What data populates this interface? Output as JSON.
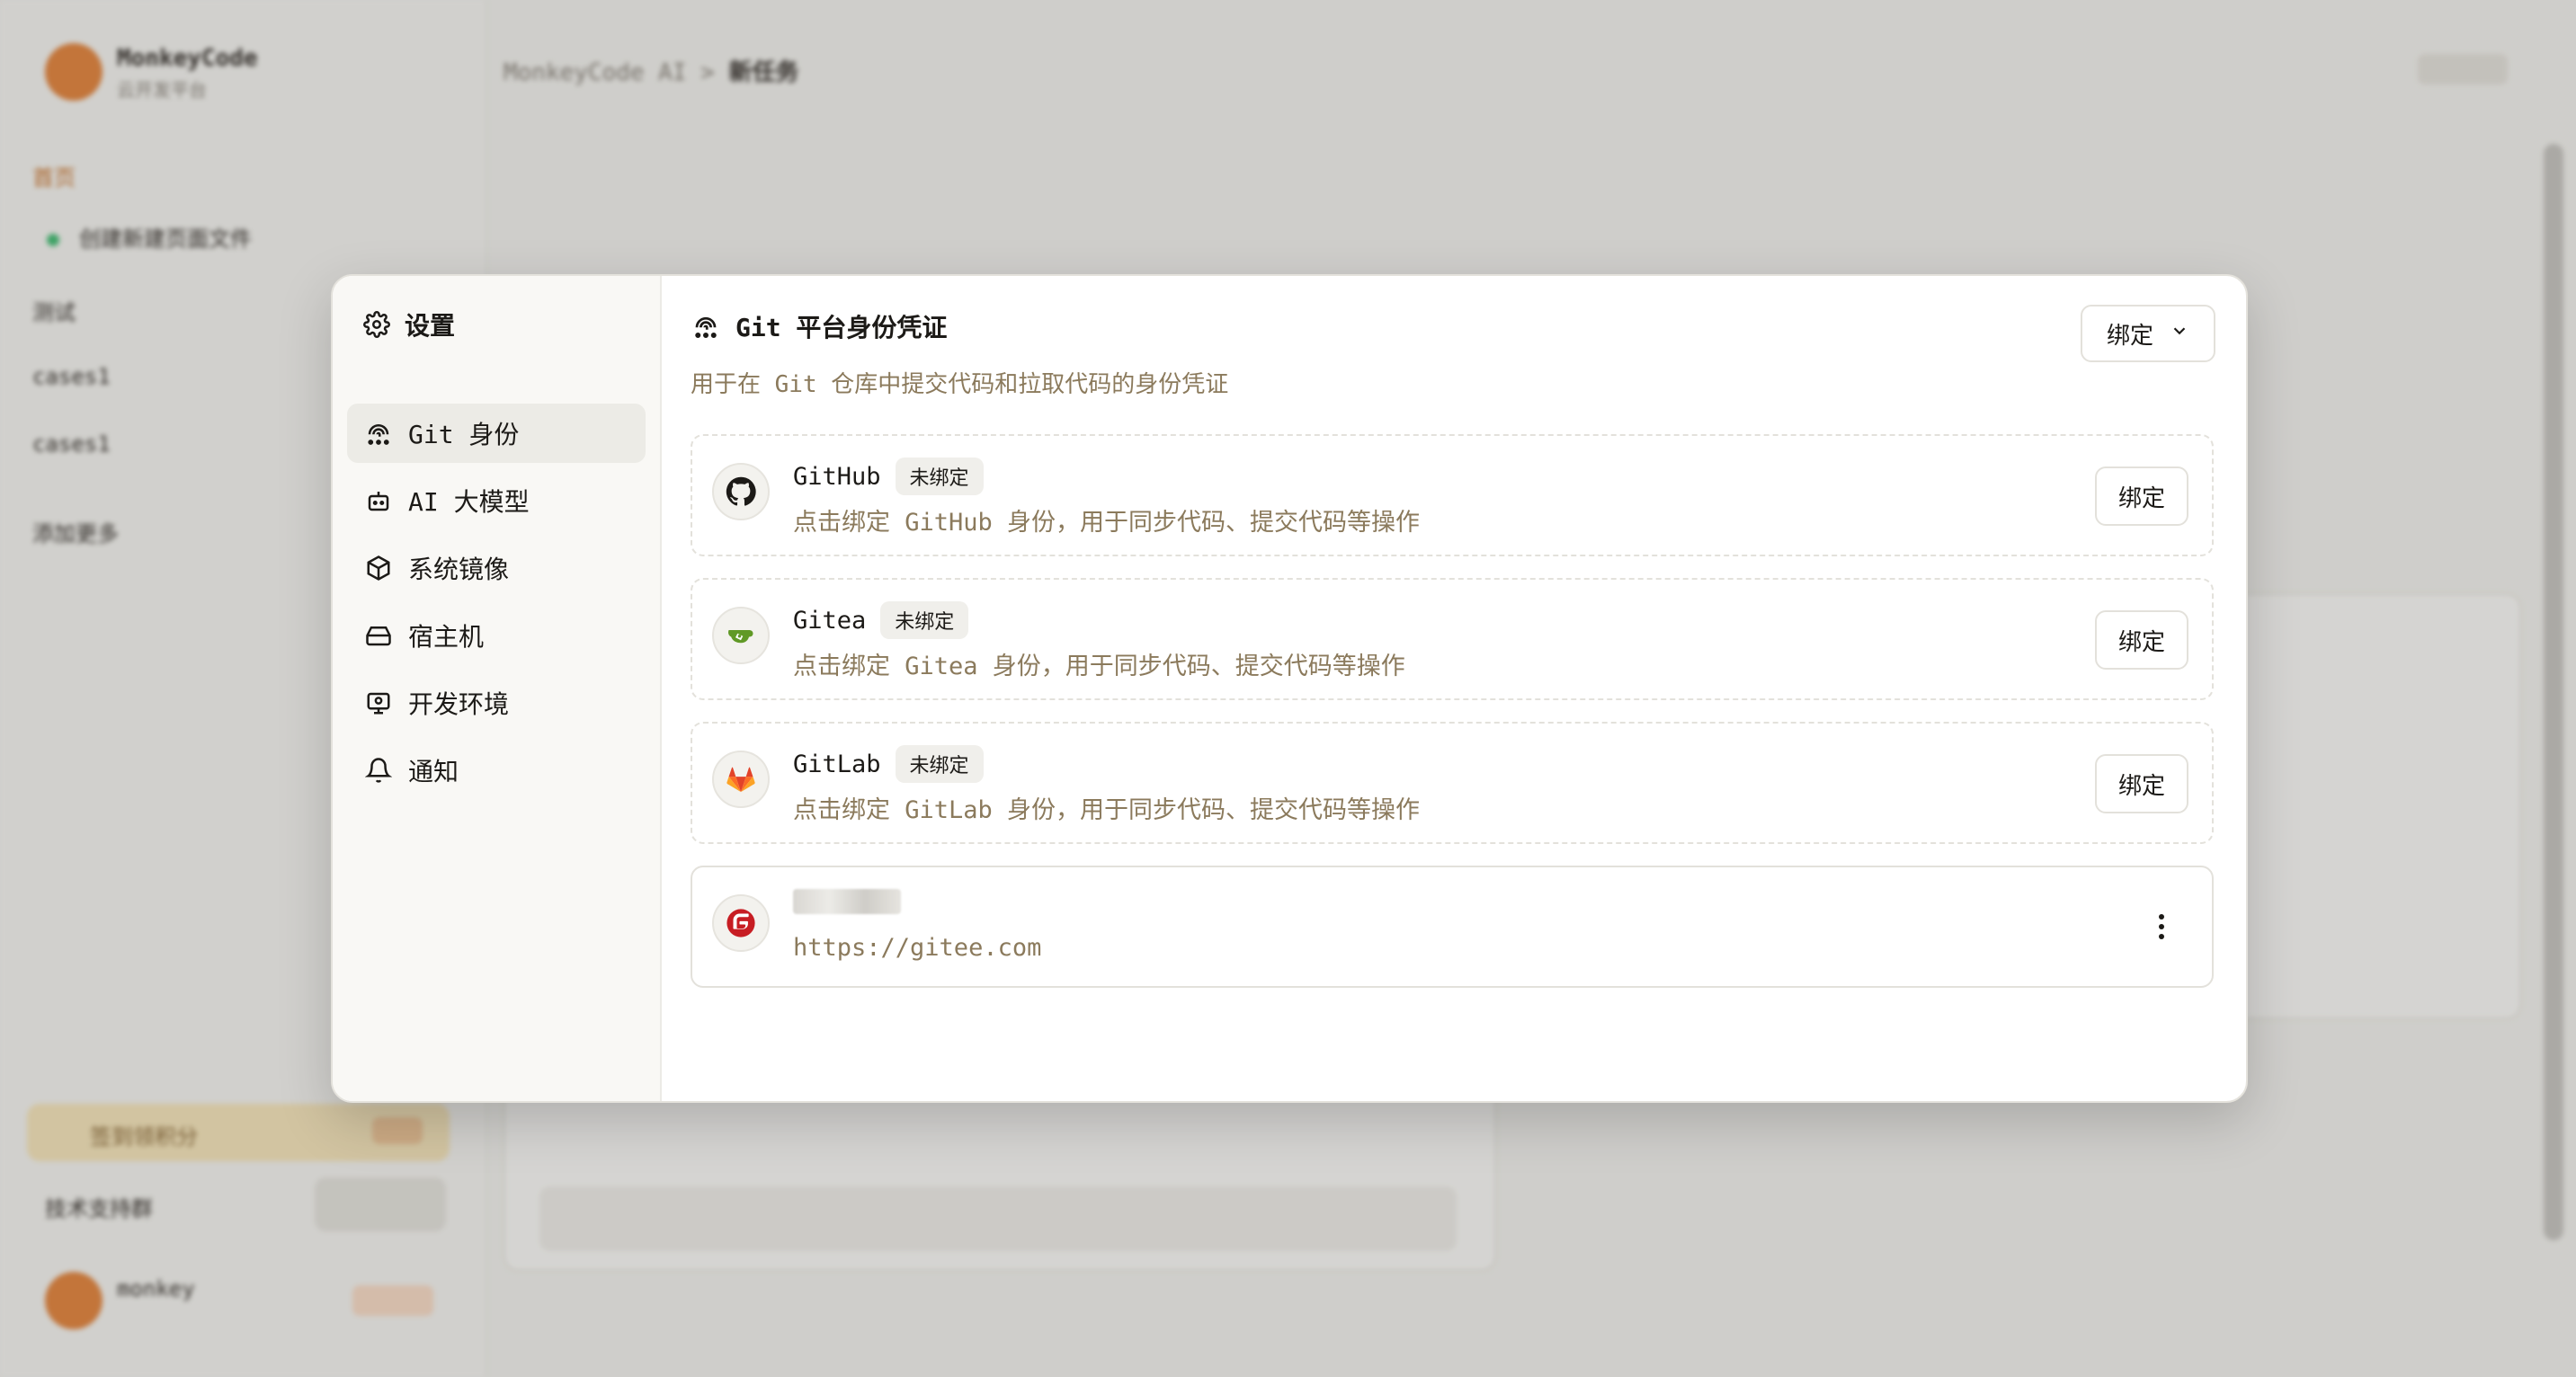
{
  "background": {
    "brand": "MonkeyCode",
    "brand_sub": "云开发平台",
    "nav": [
      "首页",
      "创建新建页面文件",
      "测试",
      "cases1",
      "cases1",
      "添加更多"
    ],
    "header_path": "MonkeyCode AI",
    "header_current": "新任务",
    "promo": "签到领积分",
    "item": "技术支持群",
    "user": "monkey"
  },
  "modal": {
    "sidebar": {
      "title": "设置",
      "items": [
        {
          "label": "Git 身份",
          "icon": "fingerprint-icon",
          "active": true
        },
        {
          "label": "AI 大模型",
          "icon": "robot-icon",
          "active": false
        },
        {
          "label": "系统镜像",
          "icon": "box-icon",
          "active": false
        },
        {
          "label": "宿主机",
          "icon": "hard-drive-icon",
          "active": false
        },
        {
          "label": "开发环境",
          "icon": "monitor-icon",
          "active": false
        },
        {
          "label": "通知",
          "icon": "bell-icon",
          "active": false
        }
      ]
    },
    "main": {
      "title": "Git 平台身份凭证",
      "subtitle": "用于在 Git 仓库中提交代码和拉取代码的身份凭证",
      "bind_dropdown": "绑定",
      "platforms": [
        {
          "name": "GitHub",
          "status": "未绑定",
          "desc": "点击绑定 GitHub 身份，用于同步代码、提交代码等操作",
          "button": "绑定",
          "icon": "github-icon"
        },
        {
          "name": "Gitea",
          "status": "未绑定",
          "desc": "点击绑定 Gitea 身份，用于同步代码、提交代码等操作",
          "button": "绑定",
          "icon": "gitea-icon"
        },
        {
          "name": "GitLab",
          "status": "未绑定",
          "desc": "点击绑定 GitLab 身份，用于同步代码、提交代码等操作",
          "button": "绑定",
          "icon": "gitlab-icon"
        }
      ],
      "bound": {
        "url": "https://gitee.com",
        "icon": "gitee-icon"
      }
    }
  }
}
